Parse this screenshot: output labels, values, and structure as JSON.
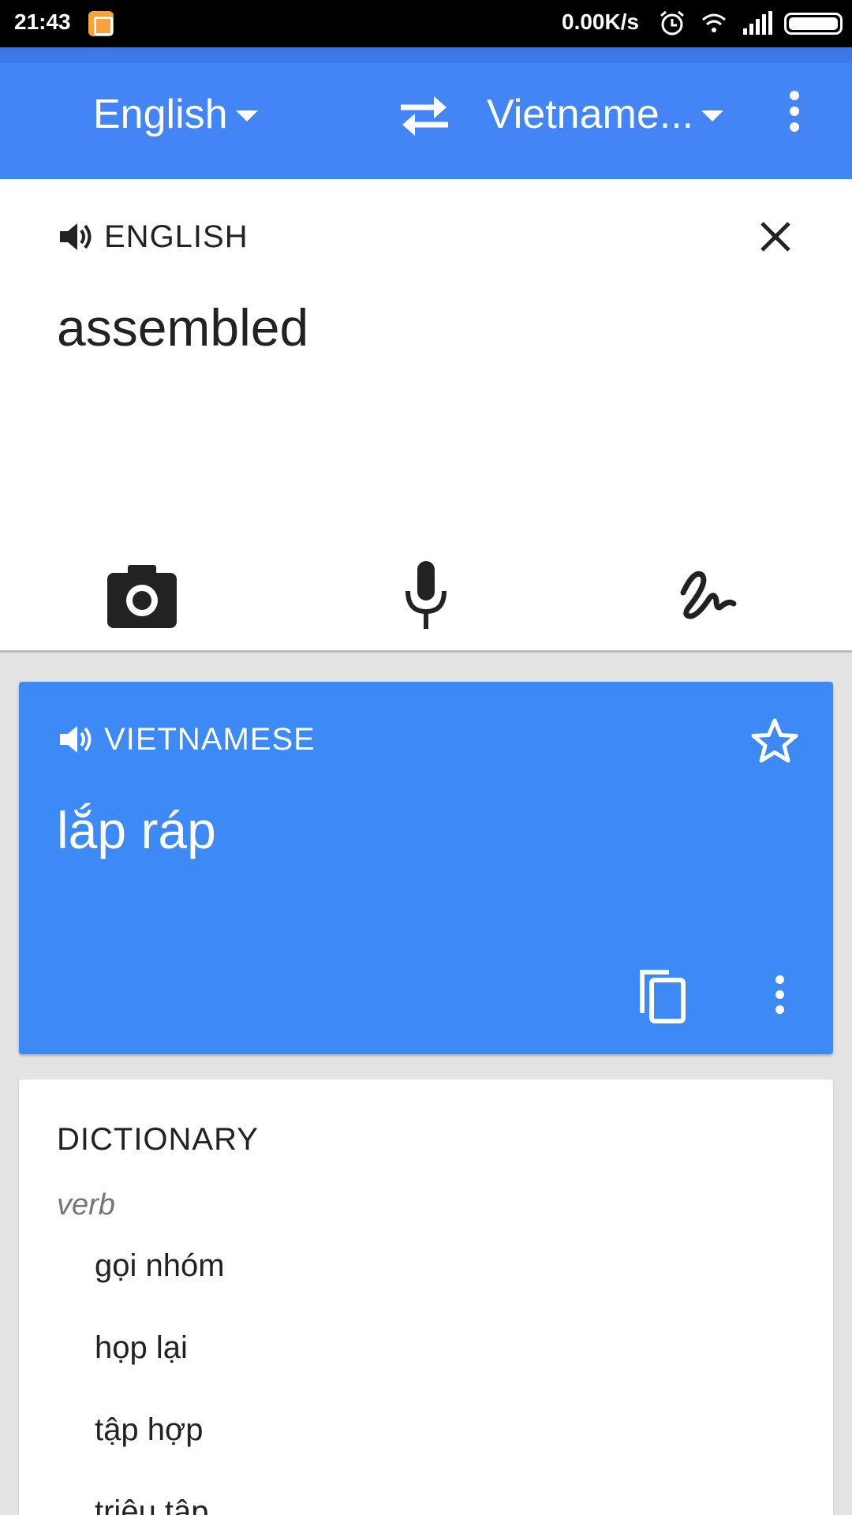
{
  "status_bar": {
    "time": "21:43",
    "network_speed": "0.00K/s",
    "icons": [
      "app-notification-icon",
      "alarm-icon",
      "wifi-icon",
      "signal-icon",
      "battery-icon"
    ]
  },
  "toolbar": {
    "source_language": "English",
    "target_language": "Vietname...",
    "swap_icon": "swap-arrows-icon",
    "menu_icon": "more-vert-icon",
    "color": "#4385f4"
  },
  "input_card": {
    "language_label": "ENGLISH",
    "text": "assembled",
    "tools": [
      "camera-icon",
      "microphone-icon",
      "handwriting-icon"
    ]
  },
  "translation_card": {
    "language_label": "VIETNAMESE",
    "text": "lắp ráp",
    "color": "#3d8af7"
  },
  "dictionary": {
    "title": "DICTIONARY",
    "part_of_speech": "verb",
    "entries": [
      "gọi nhóm",
      "họp lại",
      "tập hợp",
      "triệu tập"
    ]
  }
}
